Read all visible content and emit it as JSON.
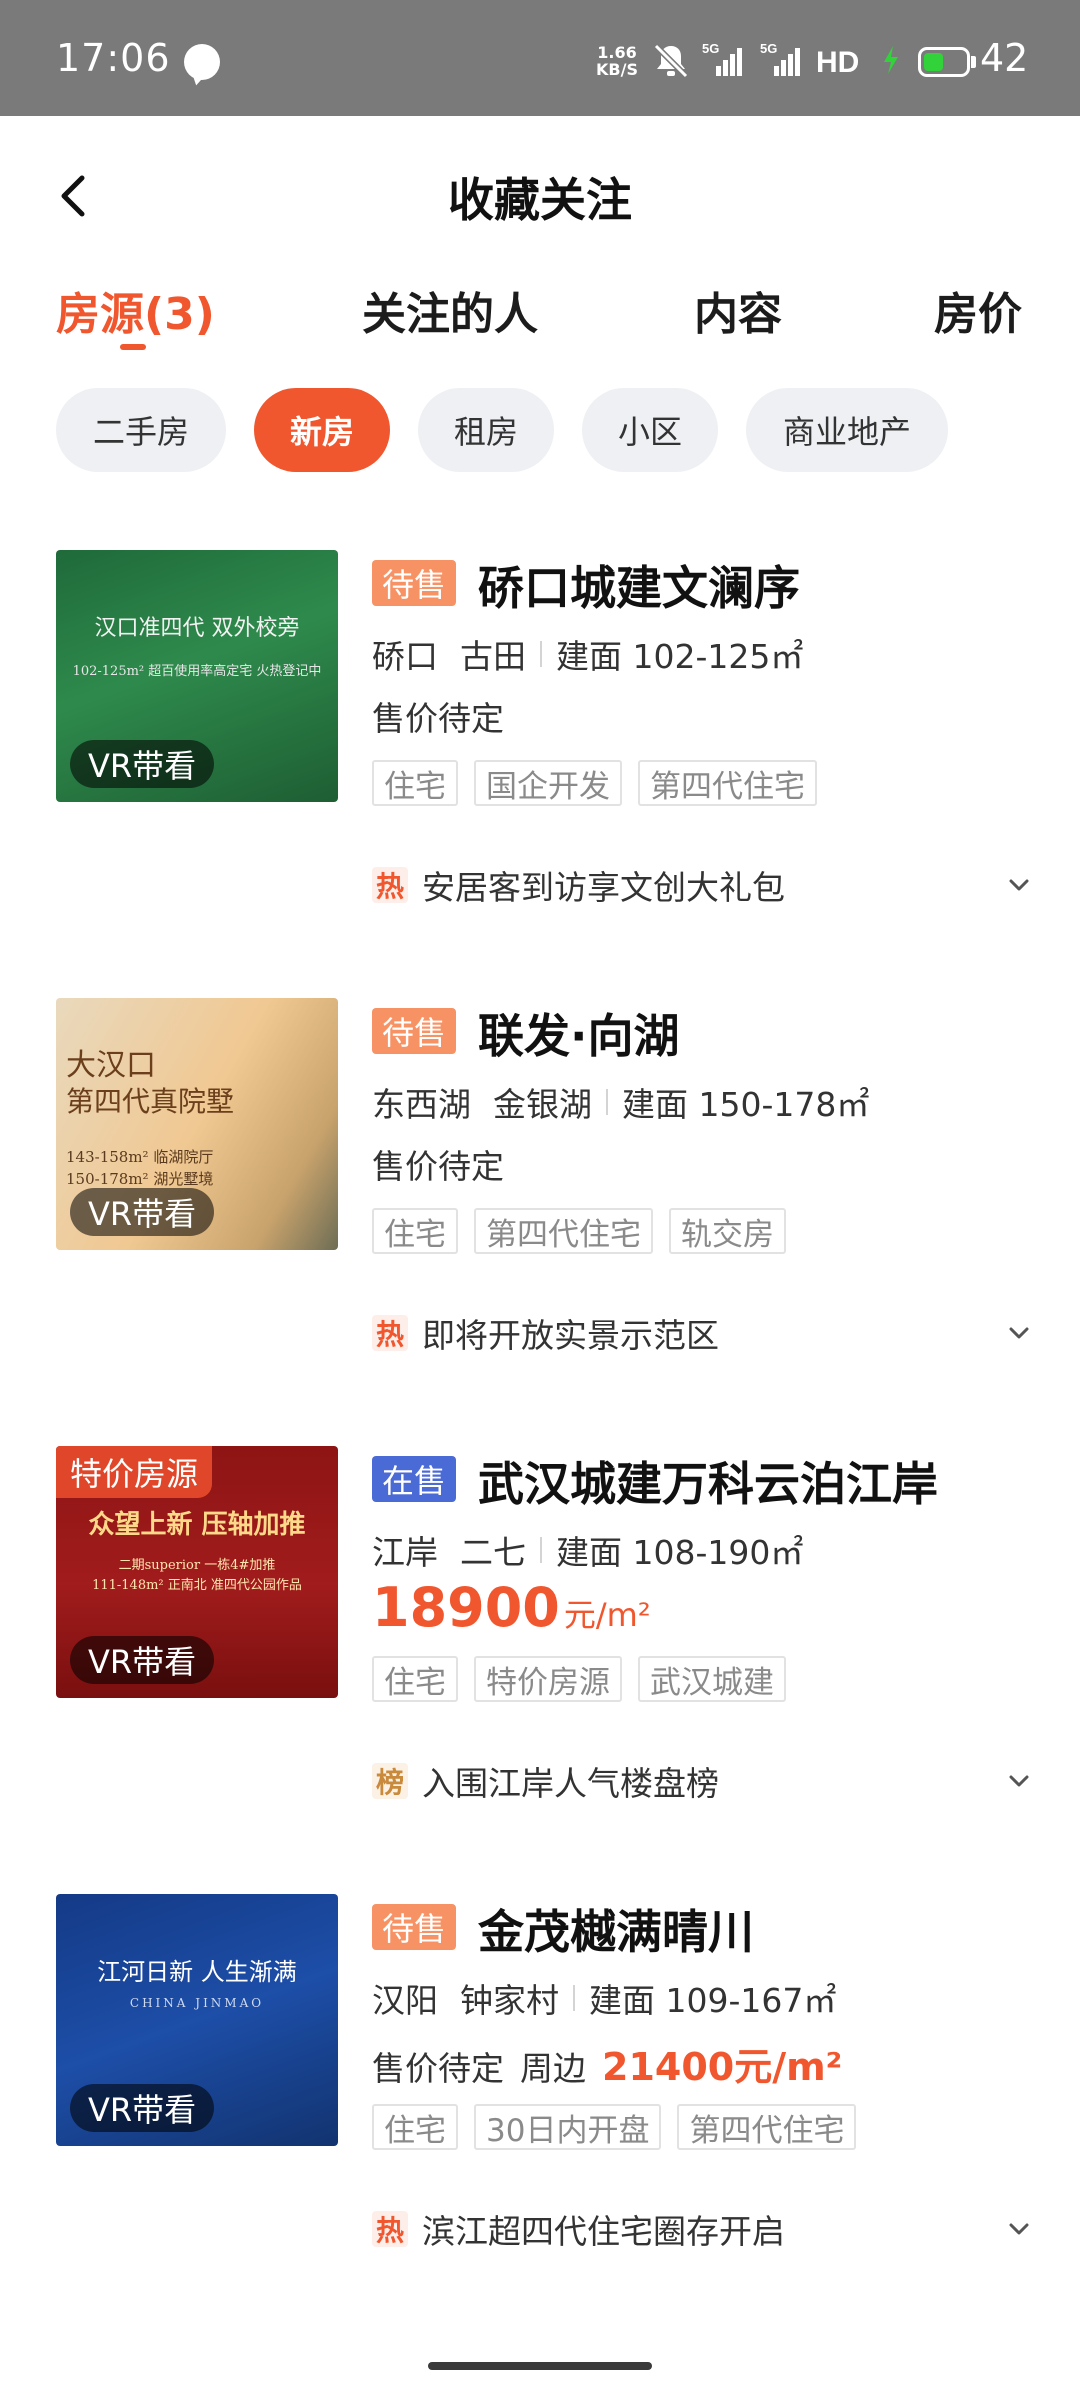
{
  "status_bar": {
    "time": "17:06",
    "speed_value": "1.66",
    "speed_unit": "KB/S",
    "network_1": "5G",
    "network_2": "5G",
    "hd_label": "HD",
    "battery_level": "42"
  },
  "header": {
    "title": "收藏关注"
  },
  "tabs": [
    {
      "label": "房源(3)",
      "active": true
    },
    {
      "label": "关注的人",
      "active": false
    },
    {
      "label": "内容",
      "active": false
    },
    {
      "label": "房价",
      "active": false
    }
  ],
  "filters": [
    {
      "label": "二手房",
      "active": false
    },
    {
      "label": "新房",
      "active": true
    },
    {
      "label": "租房",
      "active": false
    },
    {
      "label": "小区",
      "active": false
    },
    {
      "label": "商业地产",
      "active": false
    }
  ],
  "listings": [
    {
      "status": "待售",
      "name": "硚口城建文澜序",
      "district": "硚口",
      "area": "古田",
      "size": "建面 102-125㎡",
      "price_text": "售价待定",
      "tags": [
        "住宅",
        "国企开发",
        "第四代住宅"
      ],
      "hot_icon": "热",
      "hot_text": "安居客到访享文创大礼包",
      "vr_label": "VR带看",
      "image_text_1": "汉口准四代 双外校旁",
      "image_text_2": "102-125m² 超百使用率高定宅 火热登记中"
    },
    {
      "status": "待售",
      "name": "联发·向湖",
      "district": "东西湖",
      "area": "金银湖",
      "size": "建面 150-178㎡",
      "price_text": "售价待定",
      "tags": [
        "住宅",
        "第四代住宅",
        "轨交房"
      ],
      "hot_icon": "热",
      "hot_text": "即将开放实景示范区",
      "vr_label": "VR带看",
      "image_text_1": "大汉口",
      "image_text_2": "第四代真院墅",
      "image_text_3": "143-158m² 临湖院厅",
      "image_text_4": "150-178m² 湖光墅境"
    },
    {
      "status": "在售",
      "name": "武汉城建万科云泊江岸",
      "district": "江岸",
      "area": "二七",
      "size": "建面 108-190㎡",
      "price_value": "18900",
      "price_unit": "元/m²",
      "tags": [
        "住宅",
        "特价房源",
        "武汉城建"
      ],
      "hot_icon": "榜",
      "hot_text": "入围江岸人气楼盘榜",
      "vr_label": "VR带看",
      "promo_label": "特价房源",
      "image_text_1": "众望上新 压轴加推",
      "image_text_2": "二期superior 一栋4#加推",
      "image_text_3": "111-148m² 正南北 准四代公园作品"
    },
    {
      "status": "待售",
      "name": "金茂樾满晴川",
      "district": "汉阳",
      "area": "钟家村",
      "size": "建面 109-167㎡",
      "price_text": "售价待定",
      "nearby_label": "周边",
      "nearby_price": "21400元/m²",
      "tags": [
        "住宅",
        "30日内开盘",
        "第四代住宅"
      ],
      "hot_icon": "热",
      "hot_text": "滨江超四代住宅圈存开启",
      "vr_label": "VR带看",
      "image_text_1": "江河日新 人生渐满",
      "image_text_2": "CHINA JINMAO"
    }
  ]
}
